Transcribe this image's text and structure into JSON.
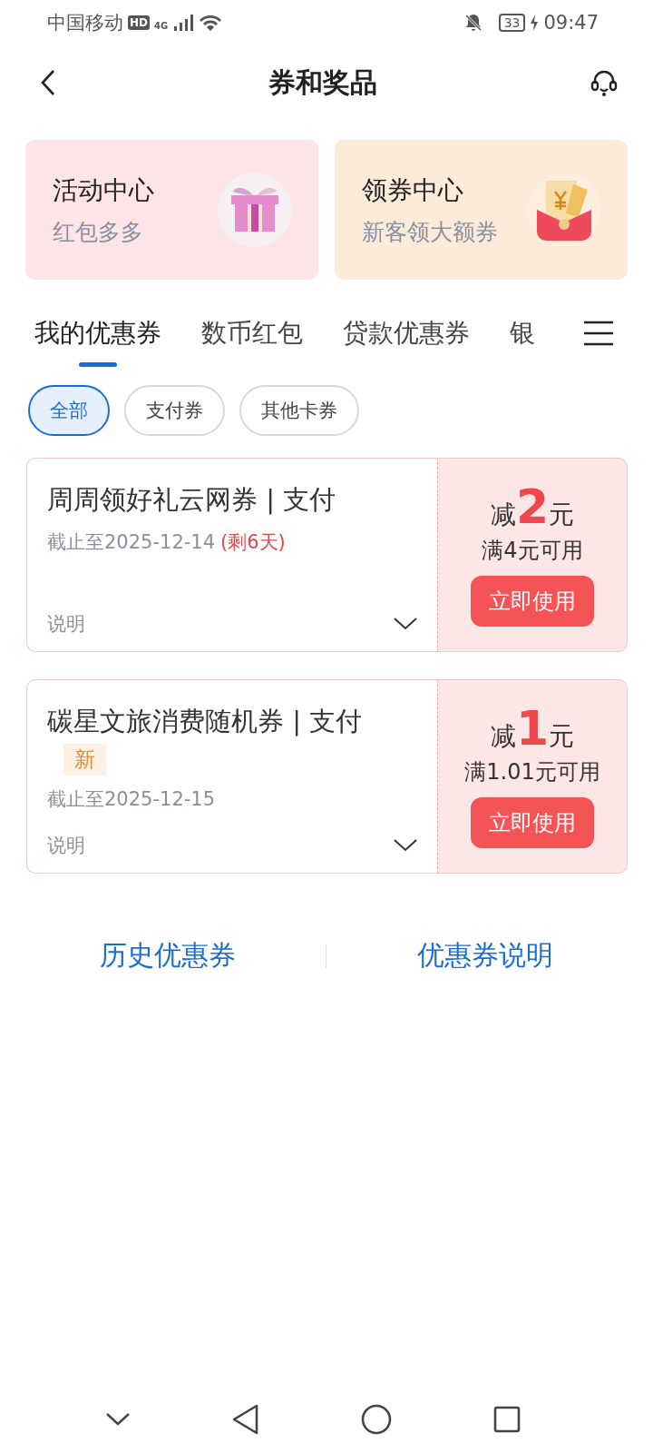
{
  "status_bar": {
    "carrier": "中国移动",
    "hd": "HD",
    "network": "4G",
    "battery": "33",
    "time": "09:47"
  },
  "header": {
    "title": "券和奖品"
  },
  "promo_cards": [
    {
      "title": "活动中心",
      "subtitle": "红包多多",
      "kind": "gift"
    },
    {
      "title": "领券中心",
      "subtitle": "新客领大额券",
      "kind": "envelope"
    }
  ],
  "tabs": [
    {
      "label": "我的优惠券",
      "selected": true
    },
    {
      "label": "数币红包",
      "selected": false
    },
    {
      "label": "贷款优惠券",
      "selected": false
    },
    {
      "label": "银",
      "selected": false
    }
  ],
  "filters": [
    {
      "label": "全部",
      "selected": true
    },
    {
      "label": "支付券",
      "selected": false
    },
    {
      "label": "其他卡券",
      "selected": false
    }
  ],
  "coupons": [
    {
      "title": "周周领好礼云网券 | 支付",
      "expiry": "截止至2025-12-14",
      "remaining": "(剩6天)",
      "details": "说明",
      "prefix": "减",
      "amount": "2",
      "unit": "元",
      "condition": "满4元可用",
      "button": "立即使用"
    },
    {
      "title": "碳星文旅消费随机券 | 支付",
      "tag": "新",
      "expiry": "截止至2025-12-15",
      "details": "说明",
      "prefix": "减",
      "amount": "1",
      "unit": "元",
      "condition": "满1.01元可用",
      "button": "立即使用"
    }
  ],
  "footer_links": [
    "历史优惠券",
    "优惠券说明"
  ]
}
